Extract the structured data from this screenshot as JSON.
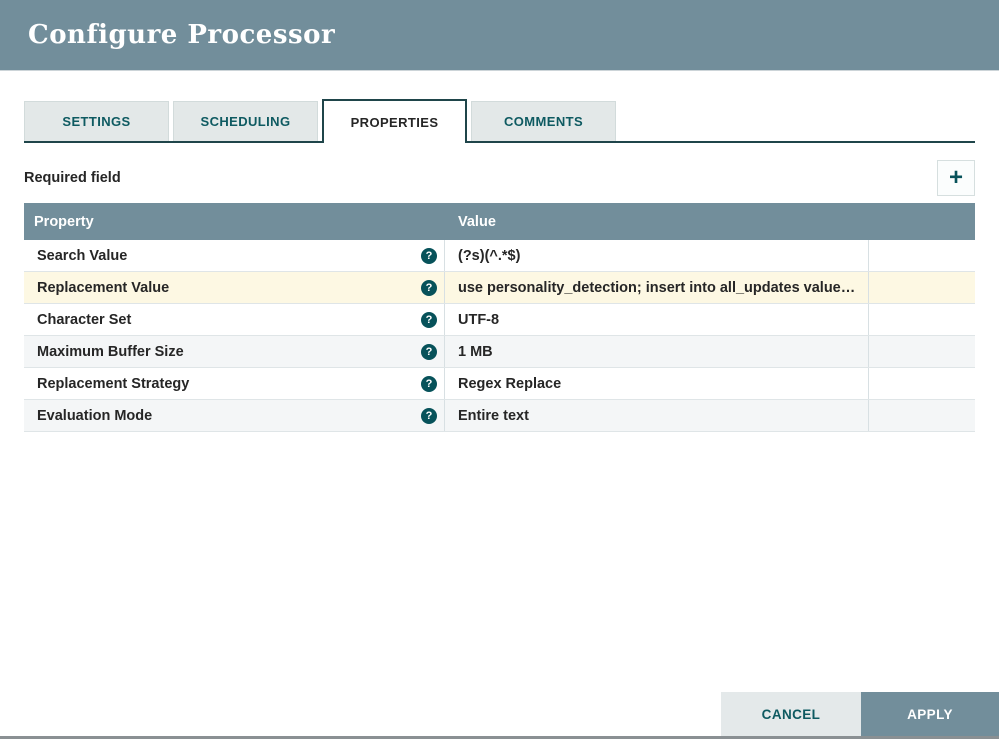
{
  "dialog": {
    "title": "Configure Processor"
  },
  "tabs": [
    {
      "label": "SETTINGS",
      "active": false
    },
    {
      "label": "SCHEDULING",
      "active": false
    },
    {
      "label": "PROPERTIES",
      "active": true
    },
    {
      "label": "COMMENTS",
      "active": false
    }
  ],
  "properties_panel": {
    "required_field_label": "Required field",
    "add_glyph": "+"
  },
  "table": {
    "columns": [
      "Property",
      "Value"
    ],
    "help_glyph": "?",
    "rows": [
      {
        "property": "Search Value",
        "value": "(?s)(^.*$)",
        "highlighted": false
      },
      {
        "property": "Replacement Value",
        "value": "use personality_detection; insert into all_updates value…",
        "highlighted": true
      },
      {
        "property": "Character Set",
        "value": "UTF-8",
        "highlighted": false
      },
      {
        "property": "Maximum Buffer Size",
        "value": "1 MB",
        "highlighted": false
      },
      {
        "property": "Replacement Strategy",
        "value": "Regex Replace",
        "highlighted": false
      },
      {
        "property": "Evaluation Mode",
        "value": "Entire text",
        "highlighted": false
      }
    ]
  },
  "actions": {
    "cancel_label": "CANCEL",
    "apply_label": "APPLY"
  },
  "colors": {
    "header_bg": "#728e9b",
    "tab_text_teal": "#0e5a61",
    "active_tab_border": "#1f454a",
    "highlight_row": "#fdf8e3",
    "alt_row": "#f4f6f7",
    "help_icon_bg": "#07525a"
  }
}
